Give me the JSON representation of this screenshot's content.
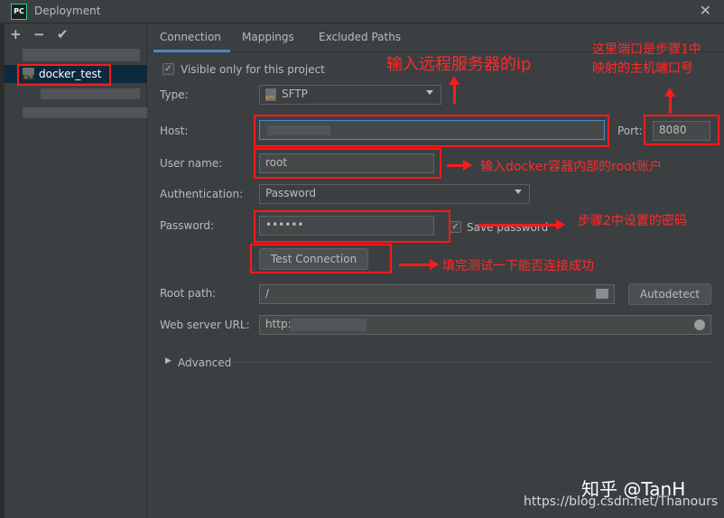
{
  "window": {
    "title": "Deployment",
    "app_icon": "PC"
  },
  "sidebar": {
    "tools": {
      "add": "+",
      "remove": "−",
      "apply": "✔"
    },
    "servers": [
      {
        "name": "docker_test"
      }
    ]
  },
  "tabs": [
    {
      "label": "Connection"
    },
    {
      "label": "Mappings"
    },
    {
      "label": "Excluded Paths"
    }
  ],
  "form": {
    "visible_only_label": "Visible only for this project",
    "type_label": "Type:",
    "type_value": "SFTP",
    "type_icon_text": "SFTP",
    "host_label": "Host:",
    "host_value": "",
    "port_label": "Port:",
    "port_value": "8080",
    "username_label": "User name:",
    "username_value": "root",
    "auth_label": "Authentication:",
    "auth_value": "Password",
    "password_label": "Password:",
    "password_value": "••••••",
    "save_password_label": "Save password",
    "test_connection_label": "Test Connection",
    "root_path_label": "Root path:",
    "root_path_value": "/",
    "autodetect_label": "Autodetect",
    "web_url_label": "Web server URL:",
    "web_url_value": "http:",
    "advanced_label": "Advanced"
  },
  "annotations": {
    "host_note": "输入远程服务器的ip",
    "port_note_line1": "这里端口是步骤1中",
    "port_note_line2": "映射的主机端口号",
    "username_note": "输入docker容器内部的root账户",
    "password_note": "步骤2中设置的密码",
    "test_note": "填完测试一下能否连接成功"
  },
  "watermark": {
    "zhihu": "知乎 @TanH",
    "csdn": "https://blog.csdn.net/Thanours"
  },
  "colors": {
    "background": "#3c3f41",
    "accent_tab": "#4a88c7",
    "selection": "#0d293e",
    "annotation": "#ff1a1a"
  }
}
